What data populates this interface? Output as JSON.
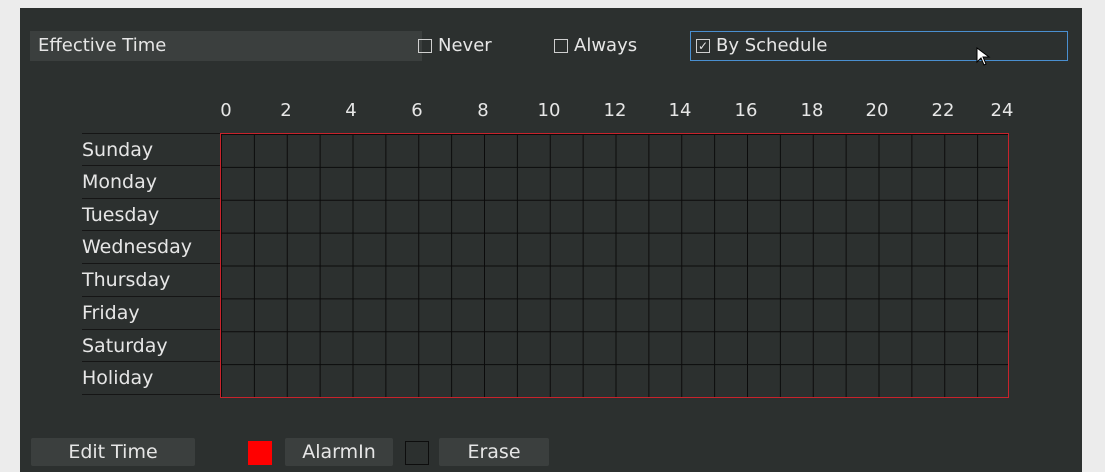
{
  "effective_time": {
    "label": "Effective Time",
    "options": [
      {
        "label": "Never",
        "checked": false,
        "check_glyph": ""
      },
      {
        "label": "Always",
        "checked": false,
        "check_glyph": ""
      },
      {
        "label": "By Schedule",
        "checked": true,
        "check_glyph": "✓"
      }
    ]
  },
  "schedule": {
    "hour_labels": [
      "0",
      "2",
      "4",
      "6",
      "8",
      "10",
      "12",
      "14",
      "16",
      "18",
      "20",
      "22",
      "24"
    ],
    "days": [
      "Sunday",
      "Monday",
      "Tuesday",
      "Wednesday",
      "Thursday",
      "Friday",
      "Saturday",
      "Holiday"
    ]
  },
  "toolbar": {
    "edit_time": "Edit Time",
    "alarmin": "AlarmIn",
    "erase": "Erase"
  },
  "colors": {
    "alarm_swatch": "#ff0000",
    "grid_border": "#c8232c",
    "selected_border": "#4a8fd0"
  }
}
